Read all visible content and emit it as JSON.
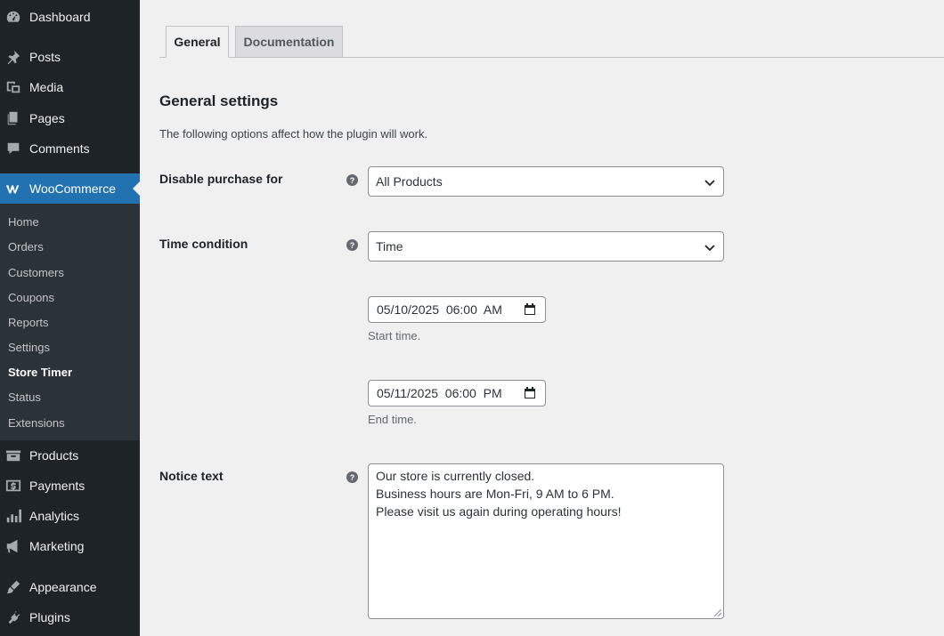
{
  "sidebar": {
    "top_items": [
      {
        "label": "Dashboard",
        "icon": "dashboard-icon"
      },
      {
        "label": "Posts",
        "icon": "pin-icon"
      },
      {
        "label": "Media",
        "icon": "media-icon"
      },
      {
        "label": "Pages",
        "icon": "pages-icon"
      },
      {
        "label": "Comments",
        "icon": "comment-icon"
      },
      {
        "label": "WooCommerce",
        "icon": "woocommerce-icon"
      }
    ],
    "submenu": [
      "Home",
      "Orders",
      "Customers",
      "Coupons",
      "Reports",
      "Settings",
      "Store Timer",
      "Status",
      "Extensions"
    ],
    "bottom_items": [
      {
        "label": "Products",
        "icon": "products-icon"
      },
      {
        "label": "Payments",
        "icon": "payments-icon"
      },
      {
        "label": "Analytics",
        "icon": "analytics-icon"
      },
      {
        "label": "Marketing",
        "icon": "megaphone-icon"
      },
      {
        "label": "Appearance",
        "icon": "brush-icon"
      },
      {
        "label": "Plugins",
        "icon": "plug-icon"
      }
    ],
    "active_item": "WooCommerce",
    "current_subitem": "Store Timer",
    "accent_color": "#2271b1"
  },
  "tabs": [
    {
      "label": "General",
      "active": true
    },
    {
      "label": "Documentation",
      "active": false
    }
  ],
  "settings": {
    "title": "General settings",
    "description": "The following options affect how the plugin will work.",
    "disable_purchase": {
      "label": "Disable purchase for",
      "value": "All Products"
    },
    "time_condition": {
      "label": "Time condition",
      "value": "Time"
    },
    "start_time": {
      "value": "05/10/2025  06:00  AM",
      "description": "Start time."
    },
    "end_time": {
      "value": "05/11/2025  06:00  PM",
      "description": "End time."
    },
    "notice": {
      "label": "Notice text",
      "lines": [
        "Our store is currently closed.",
        "Business hours are Mon-Fri, 9 AM to 6 PM.",
        "Please visit us again during operating hours!"
      ]
    },
    "help_glyph": "?"
  }
}
